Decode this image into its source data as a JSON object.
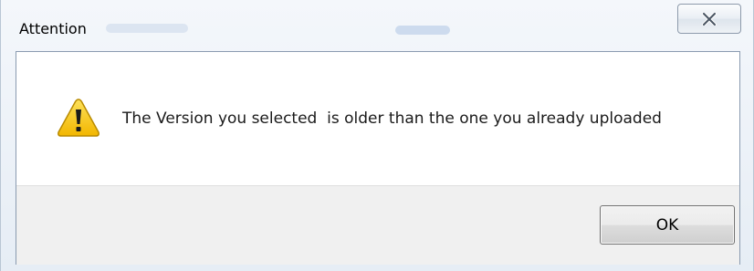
{
  "dialog": {
    "title": "Attention",
    "close_icon": "close-icon",
    "message_icon": "warning-icon",
    "message": "The Version you selected  is older than the one you already uploaded",
    "ok_label": "OK"
  },
  "colors": {
    "warning_yellow": "#f5c400",
    "warning_border": "#b88a00",
    "button_border": "#707070",
    "footer_bg": "#f0f0f0"
  }
}
